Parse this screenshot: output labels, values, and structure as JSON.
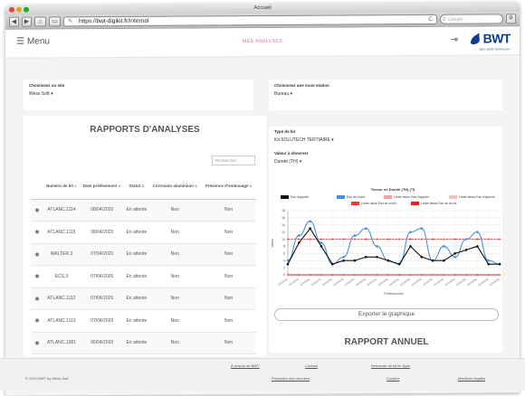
{
  "browser": {
    "window_title": "Accueil",
    "url": "https://bwt-digikit.fr/internal",
    "search_placeholder": "Google",
    "reader_label": "C",
    "back": "◀",
    "forward": "▶"
  },
  "header": {
    "menu_label": "Menu",
    "page_title": "MES ANALYSES",
    "logo_text": "BWT",
    "logo_sub": "BEST WATER TECHNOLOGY"
  },
  "filters": {
    "site_label": "Choisissez un site",
    "site_value": "Wess Soft",
    "substation_label": "Choisissez une sous-station",
    "substation_value": "Bureau"
  },
  "left": {
    "title": "RAPPORTS D'ANALYSES",
    "search_placeholder": "Rechercher",
    "columns": [
      "",
      "Numéro de kit",
      "Date prélèvement",
      "Statut",
      "Corrosion aluminium",
      "Présence d'embouage"
    ],
    "rows": [
      {
        "kit": "ATLANC.1114",
        "date": "08/04/2020",
        "status": "En attente",
        "corrosion": "Non",
        "embouage": "Non"
      },
      {
        "kit": "ATLANC.1115",
        "date": "08/04/2020",
        "status": "En attente",
        "corrosion": "Non",
        "embouage": "Non"
      },
      {
        "kit": "WALTER.3",
        "date": "07/04/2020",
        "status": "En attente",
        "corrosion": "Non",
        "embouage": "Non"
      },
      {
        "kit": "ECS.3",
        "date": "07/04/2020",
        "status": "En attente",
        "corrosion": "Non",
        "embouage": "Non"
      },
      {
        "kit": "ATLANC.1112",
        "date": "07/04/2020",
        "status": "En attente",
        "corrosion": "Non",
        "embouage": "Non"
      },
      {
        "kit": "ATLANC.1113",
        "date": "07/04/2020",
        "status": "En attente",
        "corrosion": "Non",
        "embouage": "Non"
      },
      {
        "kit": "ATLANC.1081",
        "date": "06/04/2020",
        "status": "En attente",
        "corrosion": "Non",
        "embouage": "Non"
      }
    ]
  },
  "right": {
    "kit_type_label": "Type de kit",
    "kit_type_value": "Kit SOLUTECH TERTIAIRE",
    "observe_label": "Valeur à observer",
    "observe_value": "Dureté (TH)",
    "export_label": "Exporter le graphique",
    "annual_title": "RAPPORT ANNUEL"
  },
  "chart_data": {
    "type": "line",
    "title": "Teneur en Dureté (TH) (°f)",
    "xlabel": "Prélèvements",
    "ylabel": "Valeur",
    "ylim": [
      0,
      18
    ],
    "yticks": [
      0,
      2,
      4,
      6,
      8,
      10,
      12,
      14,
      16,
      18
    ],
    "categories": [
      "10/10/2016",
      "10/10/2016",
      "10/10/2016",
      "10/10/2016",
      "10/10/2016",
      "10/10/2016",
      "10/10/2016",
      "10/10/2016",
      "10/10/2016",
      "10/10/2016",
      "10/10/2016",
      "10/10/2016",
      "10/10/2016",
      "10/10/2016",
      "10/10/2016",
      "10/10/2016",
      "10/10/2016",
      "10/10/2016",
      "10/10/2016",
      "10/10/2016"
    ],
    "series": [
      {
        "name": "Eau d'appoint",
        "color": "#111111",
        "style": "line",
        "values": [
          3,
          9,
          13,
          8,
          3,
          4,
          4,
          5,
          5,
          4,
          3,
          8,
          5,
          4,
          4,
          6,
          7,
          8,
          3,
          3
        ]
      },
      {
        "name": "Eau de circuit",
        "color": "#4a90d9",
        "style": "line",
        "values": [
          4,
          11,
          15,
          9,
          3,
          5,
          11,
          13,
          8,
          4,
          3,
          12,
          13,
          4,
          8,
          5,
          10,
          12,
          4,
          3
        ]
      },
      {
        "name": "Limite haute Eau d'appoint",
        "color": "#f2a0a0",
        "style": "line",
        "values": [
          10,
          10,
          10,
          10,
          10,
          10,
          10,
          10,
          10,
          10,
          10,
          10,
          10,
          10,
          10,
          10,
          10,
          10,
          10,
          10
        ]
      },
      {
        "name": "Limite basse Eau d'appoint",
        "color": "#f4c2c2",
        "style": "line",
        "values": [
          10,
          10,
          10,
          10,
          10,
          10,
          10,
          10,
          10,
          10,
          10,
          10,
          10,
          10,
          10,
          10,
          10,
          10,
          10,
          10
        ]
      },
      {
        "name": "Limite haute Eau de circuit",
        "color": "#ff3333",
        "style": "dashed",
        "values": [
          10,
          10,
          10,
          10,
          10,
          10,
          10,
          10,
          10,
          10,
          10,
          10,
          10,
          10,
          10,
          10,
          10,
          10,
          10,
          10
        ]
      },
      {
        "name": "Limite basse Eau de circuit",
        "color": "#e8231f",
        "style": "line",
        "values": [
          0,
          0,
          0,
          0,
          0,
          0,
          0,
          0,
          0,
          0,
          0,
          0,
          0,
          0,
          0,
          0,
          0,
          0,
          0,
          0
        ]
      }
    ],
    "grid": true,
    "legend": "top"
  },
  "footer": {
    "copyright": "© 2019 BWT by Wess Soft",
    "links": [
      "À propos de BWT",
      "Contact",
      "Demande de kit en ligne",
      "Protection des données",
      "Cookies",
      "Mentions légales"
    ]
  }
}
